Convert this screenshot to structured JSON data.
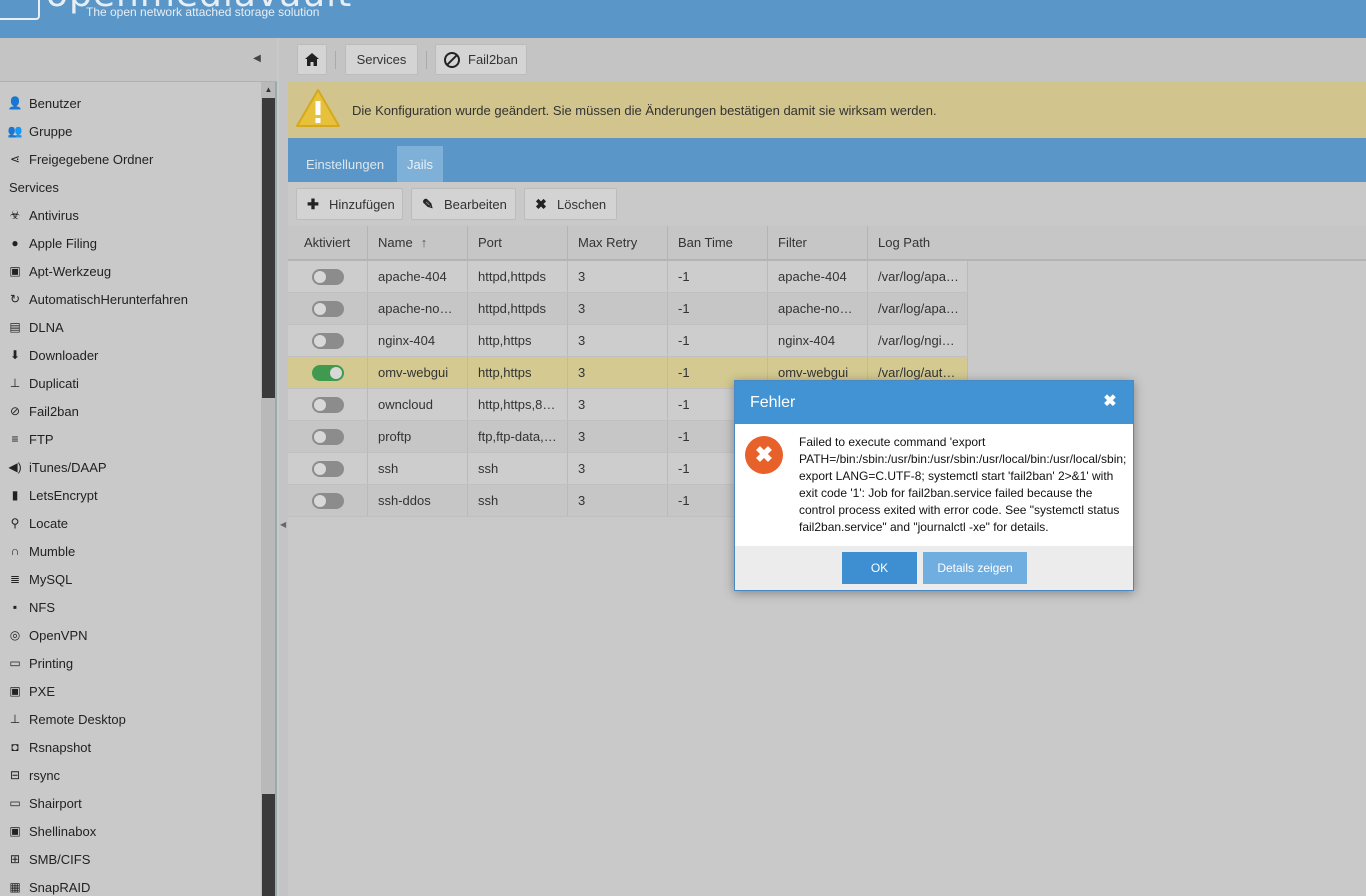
{
  "header": {
    "title": "openmediavault",
    "tagline": "The open network attached storage solution"
  },
  "nav": {
    "items": [
      {
        "label": "Benutzer",
        "icon": "user-icon"
      },
      {
        "label": "Gruppe",
        "icon": "group-icon"
      },
      {
        "label": "Freigegebene Ordner",
        "icon": "share-icon"
      },
      {
        "label": "Services",
        "icon": "",
        "header": true
      },
      {
        "label": "Antivirus",
        "icon": "biohazard-icon"
      },
      {
        "label": "Apple Filing",
        "icon": "apple-icon"
      },
      {
        "label": "Apt-Werkzeug",
        "icon": "package-icon"
      },
      {
        "label": "AutomatischHerunterfahren",
        "icon": "power-cycle-icon"
      },
      {
        "label": "DLNA",
        "icon": "film-icon"
      },
      {
        "label": "Downloader",
        "icon": "download-icon"
      },
      {
        "label": "Duplicati",
        "icon": "sitemap-icon"
      },
      {
        "label": "Fail2ban",
        "icon": "ban-icon"
      },
      {
        "label": "FTP",
        "icon": "server-icon"
      },
      {
        "label": "iTunes/DAAP",
        "icon": "audio-icon"
      },
      {
        "label": "LetsEncrypt",
        "icon": "lock-icon"
      },
      {
        "label": "Locate",
        "icon": "search-icon"
      },
      {
        "label": "Mumble",
        "icon": "headphones-icon"
      },
      {
        "label": "MySQL",
        "icon": "database-icon"
      },
      {
        "label": "NFS",
        "icon": "nfs-icon"
      },
      {
        "label": "OpenVPN",
        "icon": "vpn-icon"
      },
      {
        "label": "Printing",
        "icon": "printer-icon"
      },
      {
        "label": "PXE",
        "icon": "terminal-icon"
      },
      {
        "label": "Remote Desktop",
        "icon": "sitemap-icon"
      },
      {
        "label": "Rsnapshot",
        "icon": "camera-icon"
      },
      {
        "label": "rsync",
        "icon": "network-icon"
      },
      {
        "label": "Shairport",
        "icon": "airplay-icon"
      },
      {
        "label": "Shellinabox",
        "icon": "terminal-icon"
      },
      {
        "label": "SMB/CIFS",
        "icon": "windows-icon"
      },
      {
        "label": "SnapRAID",
        "icon": "keyboard-icon"
      }
    ]
  },
  "breadcrumb": {
    "services": "Services",
    "current": "Fail2ban"
  },
  "warning": {
    "text": "Die Konfiguration wurde geändert. Sie müssen die Änderungen bestätigen damit sie wirksam werden."
  },
  "tabs": [
    {
      "label": "Einstellungen",
      "active": false
    },
    {
      "label": "Jails",
      "active": true
    }
  ],
  "toolbar": {
    "add": "Hinzufügen",
    "edit": "Bearbeiten",
    "delete": "Löschen"
  },
  "grid": {
    "columns": [
      "Aktiviert",
      "Name",
      "Port",
      "Max Retry",
      "Ban Time",
      "Filter",
      "Log Path"
    ],
    "sort_indicator": "↑",
    "rows": [
      {
        "enabled": false,
        "name": "apache-404",
        "port": "httpd,httpds",
        "maxretry": "3",
        "bantime": "-1",
        "filter": "apache-404",
        "logpath": "/var/log/apa…"
      },
      {
        "enabled": false,
        "name": "apache-no…",
        "port": "httpd,httpds",
        "maxretry": "3",
        "bantime": "-1",
        "filter": "apache-no…",
        "logpath": "/var/log/apa…"
      },
      {
        "enabled": false,
        "name": "nginx-404",
        "port": "http,https",
        "maxretry": "3",
        "bantime": "-1",
        "filter": "nginx-404",
        "logpath": "/var/log/ngi…"
      },
      {
        "enabled": true,
        "name": "omv-webgui",
        "port": "http,https",
        "maxretry": "3",
        "bantime": "-1",
        "filter": "omv-webgui",
        "logpath": "/var/log/aut…"
      },
      {
        "enabled": false,
        "name": "owncloud",
        "port": "http,https,8…",
        "maxretry": "3",
        "bantime": "-1",
        "filter": "",
        "logpath": ""
      },
      {
        "enabled": false,
        "name": "proftp",
        "port": "ftp,ftp-data,…",
        "maxretry": "3",
        "bantime": "-1",
        "filter": "",
        "logpath": ""
      },
      {
        "enabled": false,
        "name": "ssh",
        "port": "ssh",
        "maxretry": "3",
        "bantime": "-1",
        "filter": "",
        "logpath": ""
      },
      {
        "enabled": false,
        "name": "ssh-ddos",
        "port": "ssh",
        "maxretry": "3",
        "bantime": "-1",
        "filter": "",
        "logpath": ""
      }
    ]
  },
  "modal": {
    "title": "Fehler",
    "message": "Failed to execute command 'export PATH=/bin:/sbin:/usr/bin:/usr/sbin:/usr/local/bin:/usr/local/sbin; export LANG=C.UTF-8; systemctl start 'fail2ban' 2>&1' with exit code '1': Job for fail2ban.service failed because the control process exited with error code. See \"systemctl status fail2ban.service\" and \"journalctl -xe\" for details.",
    "ok": "OK",
    "details": "Details zeigen"
  },
  "colors": {
    "header_blue": "#5a96c7",
    "warning_bg": "#d1c48c",
    "toggle_on": "#3f9a50",
    "error_orange": "#e8602a",
    "modal_head": "#4293d4"
  }
}
